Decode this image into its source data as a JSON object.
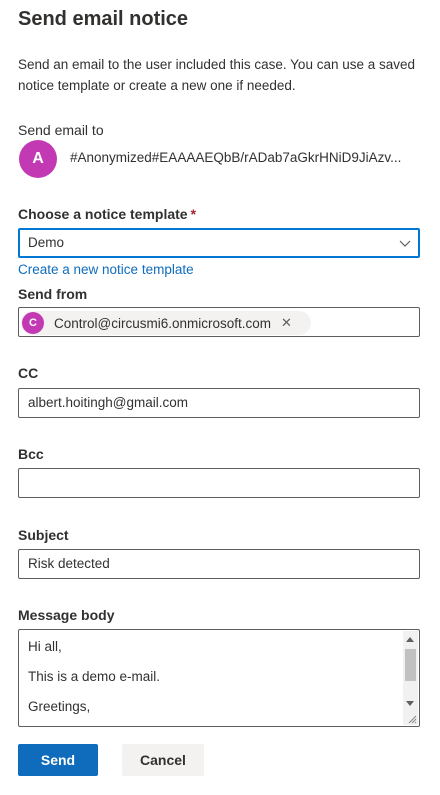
{
  "panel": {
    "title": "Send email notice",
    "description": "Send an email to the user included this case. You can use a saved notice template or create a new one if needed."
  },
  "send_to": {
    "label": "Send email to",
    "avatar_initial": "A",
    "recipient": "#Anonymized#EAAAAEQbB/rADab7aGkrHNiD9JiAzv..."
  },
  "template": {
    "label": "Choose a notice template",
    "required_mark": "*",
    "selected": "Demo",
    "create_link": "Create a new notice template"
  },
  "send_from": {
    "label": "Send from",
    "chip_initial": "C",
    "chip_text": "Control@circusmi6.onmicrosoft.com",
    "chip_remove": "✕"
  },
  "cc": {
    "label": "CC",
    "value": "albert.hoitingh@gmail.com"
  },
  "bcc": {
    "label": "Bcc",
    "value": ""
  },
  "subject": {
    "label": "Subject",
    "value": "Risk detected"
  },
  "message": {
    "label": "Message body",
    "lines": [
      "Hi all,",
      "This is a demo e-mail.",
      "Greetings,"
    ]
  },
  "actions": {
    "send_label": "Send",
    "cancel_label": "Cancel"
  },
  "colors": {
    "accent": "#0f6cbd",
    "avatar": "#c239b3",
    "required": "#a4262c"
  },
  "icons": {
    "dropdown": "chevron-down-icon",
    "chip_remove": "close-icon"
  }
}
